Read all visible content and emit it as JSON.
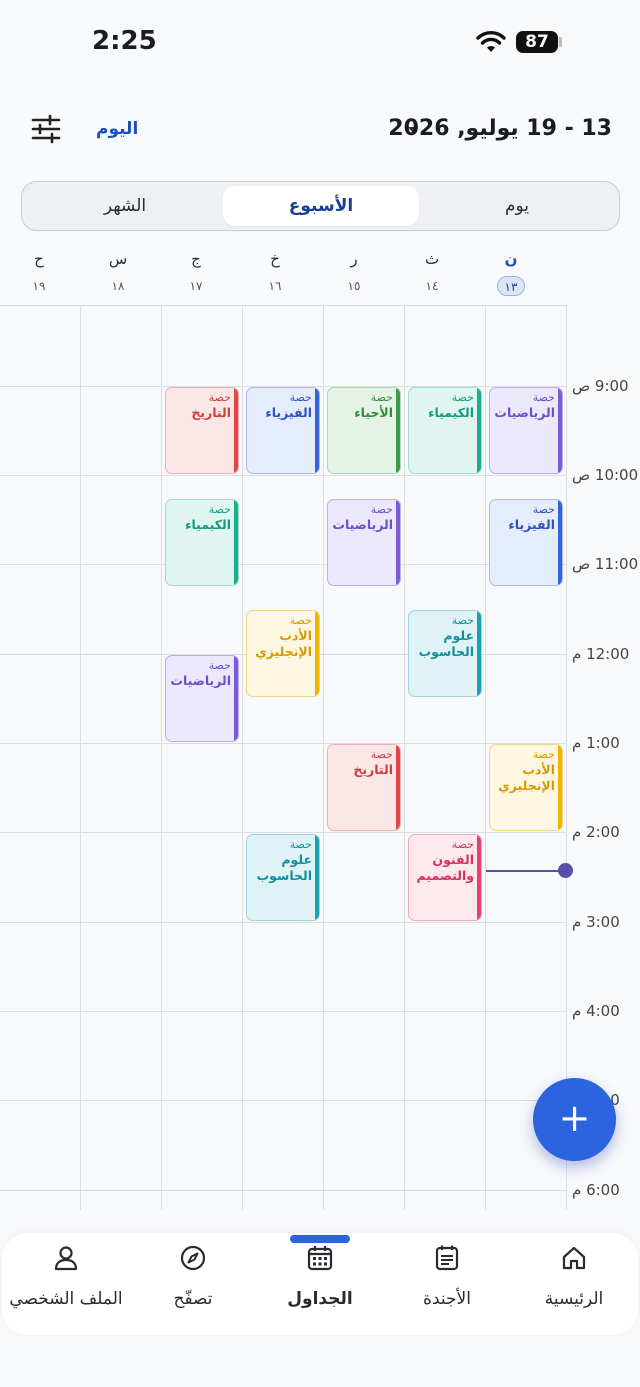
{
  "status": {
    "time": "2:25",
    "battery": "87"
  },
  "header": {
    "date_range": "13 - 19 يوليو, 2026",
    "today_label": "اليوم"
  },
  "view_switcher": {
    "day": "يوم",
    "week": "الأسبوع",
    "month": "الشهر",
    "selected": "الأسبوع"
  },
  "days": [
    {
      "name": "ن",
      "date": "١٣",
      "today": true
    },
    {
      "name": "ث",
      "date": "١٤"
    },
    {
      "name": "ر",
      "date": "١٥"
    },
    {
      "name": "خ",
      "date": "١٦"
    },
    {
      "name": "ج",
      "date": "١٧"
    },
    {
      "name": "س",
      "date": "١٨"
    },
    {
      "name": "ح",
      "date": "١٩"
    }
  ],
  "hours": [
    "9:00 ص",
    "10:00 ص",
    "11:00 ص",
    "12:00 م",
    "1:00 م",
    "2:00 م",
    "3:00 م",
    "4:00 م",
    "5:00 م",
    "6:00 م"
  ],
  "event_label": "حصة",
  "events": [
    {
      "title": "الرياضيات",
      "color": "purple"
    },
    {
      "title": "الكيمياء",
      "color": "teal"
    },
    {
      "title": "الأحياء",
      "color": "green"
    },
    {
      "title": "الفيزياء",
      "color": "blue"
    },
    {
      "title": "التاريخ",
      "color": "red"
    },
    {
      "title": "الفيزياء",
      "color": "blue"
    },
    {
      "title": "الرياضيات",
      "color": "purple"
    },
    {
      "title": "الكيمياء",
      "color": "teal"
    },
    {
      "title": "علوم الحاسوب",
      "color": "cyan"
    },
    {
      "title": "الأدب الإنجليزي",
      "color": "yellow"
    },
    {
      "title": "الرياضيات",
      "color": "purple"
    },
    {
      "title": "الأدب الإنجليزي",
      "color": "yellow"
    },
    {
      "title": "التاريخ",
      "color": "red"
    },
    {
      "title": "الفنون والتصميم",
      "color": "pink"
    },
    {
      "title": "علوم الحاسوب",
      "color": "cyan"
    }
  ],
  "fab_label": "+",
  "nav": {
    "home": "الرئيسية",
    "agenda": "الأجندة",
    "schedules": "الجداول",
    "browse": "تصفّح",
    "profile": "الملف الشخصي"
  }
}
